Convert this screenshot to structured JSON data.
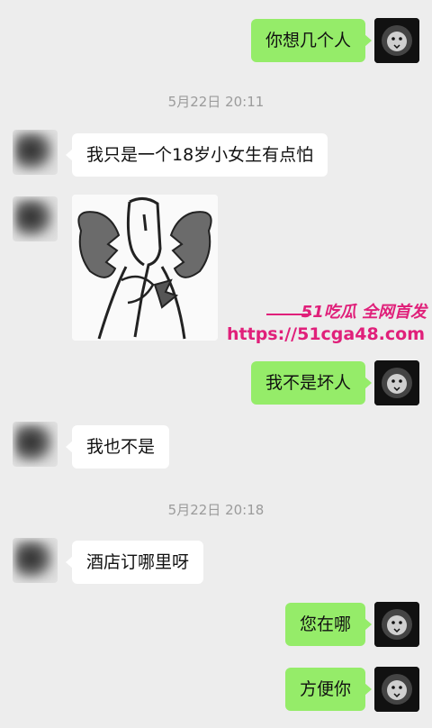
{
  "messages": [
    {
      "side": "right",
      "text": "你想几个人"
    },
    {
      "timestamp": "5月22日 20:11"
    },
    {
      "side": "left",
      "text": "我只是一个18岁小女生有点怕"
    },
    {
      "side": "left",
      "type": "sticker"
    },
    {
      "side": "right",
      "text": "我不是坏人"
    },
    {
      "side": "left",
      "text": "我也不是"
    },
    {
      "timestamp": "5月22日 20:18"
    },
    {
      "side": "left",
      "text": "酒店订哪里呀"
    },
    {
      "side": "right",
      "text": "您在哪"
    },
    {
      "side": "right",
      "text": "方便你"
    }
  ],
  "watermark": {
    "line1": "51吃瓜 全网首发",
    "line2": "https://51cga48.com",
    "color": "#e0207a"
  },
  "colors": {
    "background": "#ededed",
    "sent_bubble": "#95ec69",
    "received_bubble": "#ffffff",
    "timestamp_text": "#9b9b9b"
  },
  "icons": {
    "sent_avatar": "lion-avatar-icon",
    "received_avatar": "blurred-avatar-icon",
    "sticker": "heartbroken-figure-sticker"
  }
}
